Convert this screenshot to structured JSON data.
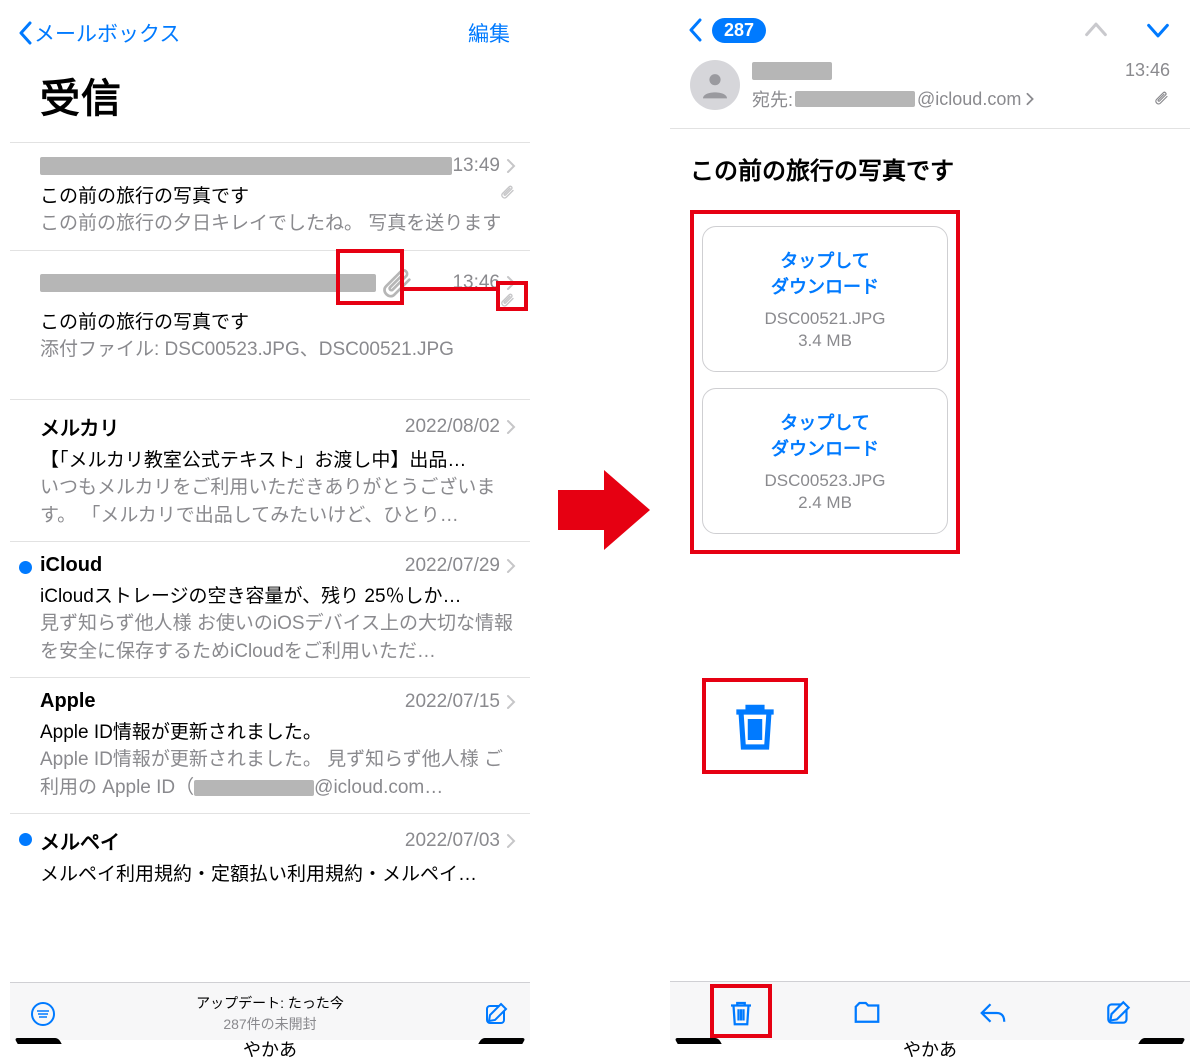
{
  "left": {
    "nav": {
      "back_label": "メールボックス",
      "edit_label": "編集"
    },
    "title": "受信",
    "messages": [
      {
        "sender_redacted": true,
        "date": "13:49",
        "has_attach": true,
        "subject": "この前の旅行の写真です",
        "preview": "この前の旅行の夕日キレイでしたね。 写真を送ります"
      },
      {
        "sender_redacted": true,
        "date": "13:46",
        "has_paperclip_big": true,
        "subject": "この前の旅行の写真です",
        "preview": "添付ファイル: DSC00523.JPG、DSC00521.JPG"
      },
      {
        "sender": "メルカリ",
        "date": "2022/08/02",
        "subject": "【「メルカリ教室公式テキスト」お渡し中】出品…",
        "preview": "いつもメルカリをご利用いただきありがとうございます。 「メルカリで出品してみたいけど、ひとり…"
      },
      {
        "unread": true,
        "sender": "iCloud",
        "date": "2022/07/29",
        "subject": "iCloudストレージの空き容量が、残り 25％しか…",
        "preview": "見ず知らず他人様 お使いのiOSデバイス上の大切な情報を安全に保存するためiCloudをご利用いただ…"
      },
      {
        "sender": "Apple",
        "date": "2022/07/15",
        "subject": "Apple ID情報が更新されました。",
        "preview_pre": "Apple ID情報が更新されました。 見ず知らず他人様 ご利用の Apple ID（",
        "preview_post": "@icloud.com…"
      },
      {
        "unread": true,
        "sender": "メルペイ",
        "date": "2022/07/03",
        "subject": "メルペイ利用規約・定額払い利用規約・メルペイ…"
      }
    ],
    "footer": {
      "updated": "アップデート: たった今",
      "unread": "287件の未開封"
    },
    "keyboard_hint": "やかあ"
  },
  "right": {
    "nav": {
      "badge": "287"
    },
    "header": {
      "time": "13:46",
      "to_label": "宛先:",
      "to_domain": "@icloud.com"
    },
    "subject": "この前の旅行の写真です",
    "attachments": [
      {
        "action1": "タップして",
        "action2": "ダウンロード",
        "filename": "DSC00521.JPG",
        "size": "3.4 MB"
      },
      {
        "action1": "タップして",
        "action2": "ダウンロード",
        "filename": "DSC00523.JPG",
        "size": "2.4 MB"
      }
    ],
    "keyboard_hint": "やかあ"
  }
}
